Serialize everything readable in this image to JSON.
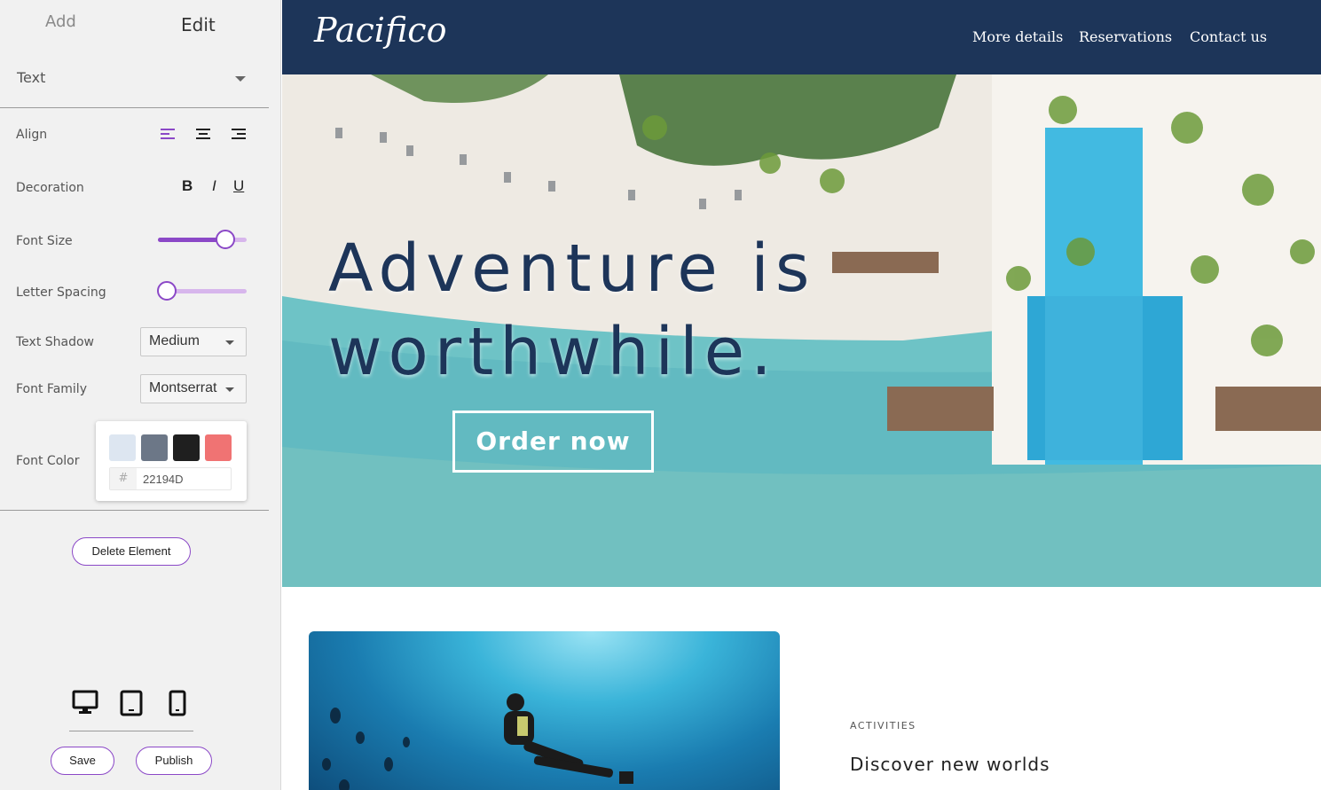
{
  "sidebar": {
    "tabs": {
      "add": "Add",
      "edit": "Edit"
    },
    "element_type": "Text",
    "align_label": "Align",
    "decoration": {
      "label": "Decoration",
      "bold": "B",
      "italic": "I",
      "underline": "U"
    },
    "font_size": {
      "label": "Font Size",
      "value_fraction": 0.76
    },
    "letter_spacing": {
      "label": "Letter Spacing",
      "value_fraction": 0.1
    },
    "text_shadow": {
      "label": "Text Shadow",
      "value": "Medium"
    },
    "font_family": {
      "label": "Font Family",
      "value": "Montserrat"
    },
    "font_color": {
      "label": "Font Color",
      "swatches": [
        "#dde6f1",
        "#6c7787",
        "#1f1f1f",
        "#f07373"
      ],
      "hex_prefix": "#",
      "hex_value": "22194D"
    },
    "delete_label": "Delete Element",
    "save_label": "Save",
    "publish_label": "Publish",
    "accent_color": "#8b48c7"
  },
  "preview": {
    "logo": "Pacifico",
    "nav": [
      "More details",
      "Reservations",
      "Contact us"
    ],
    "hero": {
      "headline_line1": "Adventure is",
      "headline_line2": "worthwhile.",
      "cta": "Order now"
    },
    "section": {
      "eyebrow": "ACTIVITIES",
      "title": "Discover new worlds"
    },
    "brand_color": "#1d3559"
  }
}
